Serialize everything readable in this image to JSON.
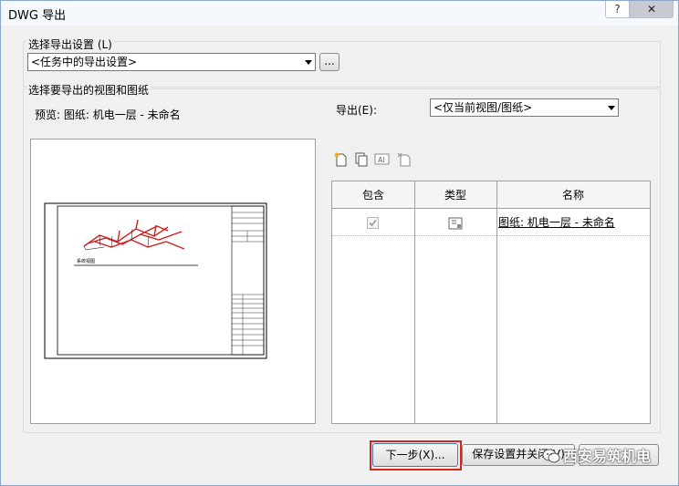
{
  "window": {
    "title": "DWG 导出",
    "help_label": "?",
    "close_label": "✕"
  },
  "settings": {
    "group_label": "选择导出设置 (L)",
    "combo_value": "<任务中的导出设置>",
    "browse_label": "..."
  },
  "views": {
    "group_label": "选择要导出的视图和图纸",
    "preview_label": "预览: 图纸: 机电一层 - 未命名",
    "export_label": "导出(E):",
    "export_combo_value": "<仅当前视图/图纸>",
    "preview_caption": "系统视图"
  },
  "toolbar": {
    "icons": [
      "new-set-icon",
      "duplicate-set-icon",
      "rename-set-icon",
      "delete-set-icon"
    ]
  },
  "table": {
    "columns": [
      "包含",
      "类型",
      "名称"
    ],
    "rows": [
      {
        "include_checked": true,
        "type_icon": "sheet-icon",
        "name": "图纸: 机电一层 - 未命名"
      }
    ]
  },
  "footer": {
    "next_label": "下一步(X)...",
    "save_close_label": "保存设置并关闭(V)",
    "watermark_text": "西安易筑机电"
  },
  "colors": {
    "highlight": "#d9231d",
    "pipe_red": "#d21f1f"
  }
}
